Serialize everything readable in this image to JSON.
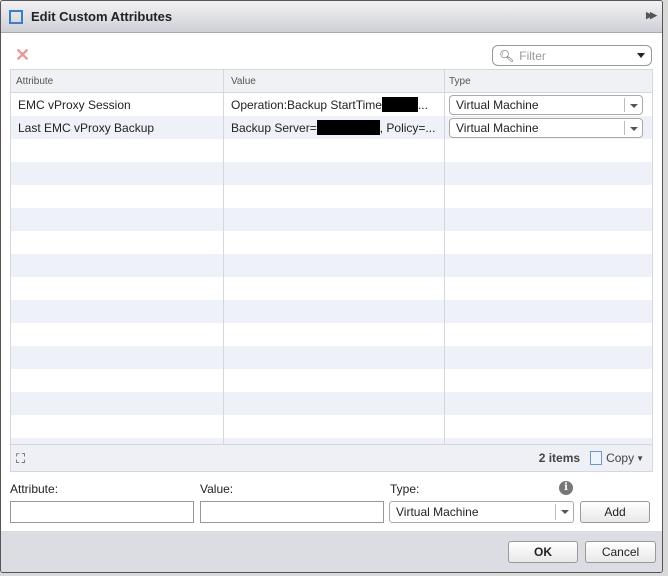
{
  "dialog": {
    "title": "Edit Custom Attributes"
  },
  "toolbar": {
    "filter_placeholder": "Filter"
  },
  "table": {
    "columns": [
      "Attribute",
      "Value",
      "Type"
    ],
    "rows": [
      {
        "attribute": "EMC vProxy Session",
        "value_prefix": "Operation:Backup StartTime",
        "value_suffix": "...",
        "type": "Virtual Machine"
      },
      {
        "attribute": "Last EMC vProxy Backup",
        "value_prefix": "Backup Server=",
        "value_suffix": ", Policy=...",
        "type": "Virtual Machine"
      }
    ],
    "count": "2 items",
    "copy_label": "Copy"
  },
  "form": {
    "attribute_label": "Attribute:",
    "value_label": "Value:",
    "type_label": "Type:",
    "type_value": "Virtual Machine",
    "add_label": "Add"
  },
  "buttons": {
    "ok": "OK",
    "cancel": "Cancel"
  }
}
